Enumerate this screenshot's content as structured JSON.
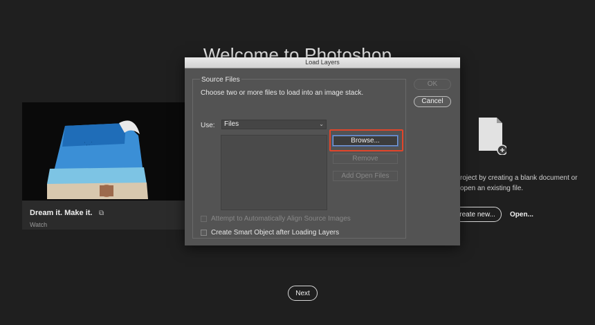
{
  "background": {
    "welcome_title": "Welcome to Photoshop",
    "video_card": {
      "title": "Dream it. Make it.",
      "subtitle": "Watch"
    },
    "start_text": "roject by creating a blank document or open an existing file.",
    "create_new_label": "Create new...",
    "open_label": "Open...",
    "next_label": "Next"
  },
  "dialog": {
    "title": "Load Layers",
    "group_title": "Source Files",
    "instructions": "Choose two or more files to load into an image stack.",
    "use_label": "Use:",
    "use_value": "Files",
    "buttons": {
      "browse": "Browse...",
      "remove": "Remove",
      "add_open_files": "Add Open Files",
      "ok": "OK",
      "cancel": "Cancel"
    },
    "checkboxes": {
      "auto_align": {
        "label": "Attempt to Automatically Align Source Images",
        "checked": false,
        "enabled": false
      },
      "smart_object": {
        "label": "Create Smart Object after Loading Layers",
        "checked": false,
        "enabled": true
      }
    }
  },
  "colors": {
    "highlight": "#e2452a",
    "dialog_bg": "#535353",
    "app_bg": "#1f1f1f"
  }
}
